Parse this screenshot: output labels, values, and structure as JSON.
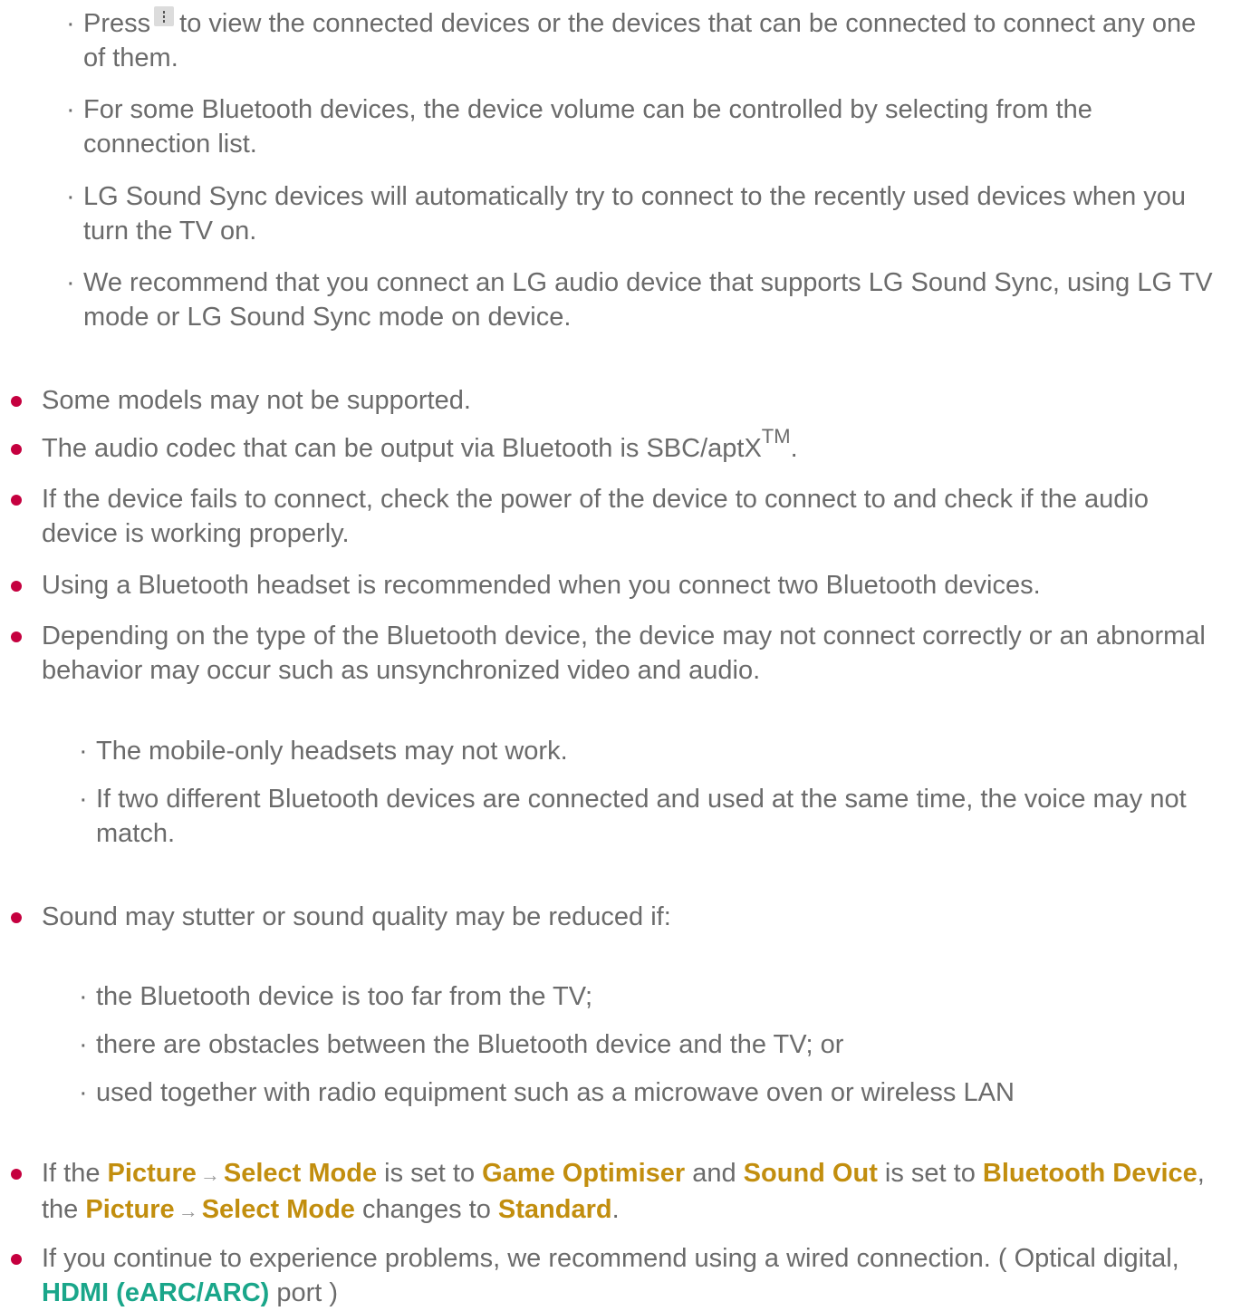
{
  "sub_list_1": [
    {
      "before_icon": "Press",
      "icon": "more-options-icon",
      "after_icon": "to view the connected devices or the devices that can be connected to connect any one of them."
    },
    {
      "text": "For some Bluetooth devices, the device volume can be controlled by selecting from the connection list."
    },
    {
      "text": "LG Sound Sync devices will automatically try to connect to the recently used devices when you turn the TV on."
    },
    {
      "text": "We recommend that you connect an LG audio device that supports LG Sound Sync, using LG TV mode or LG Sound Sync mode on device."
    }
  ],
  "notes": {
    "n1": "Some models may not be supported.",
    "n2_main": "The audio codec that can be output via Bluetooth is SBC/aptX",
    "n2_sup": "TM",
    "n2_end": ".",
    "n3": "If the device fails to connect, check the power of the device to connect to and check if the audio device is working properly.",
    "n4": "Using a Bluetooth headset is recommended when you connect two Bluetooth devices.",
    "n5": "Depending on the type of the Bluetooth device, the device may not connect correctly or an abnormal behavior may occur such as unsynchronized video and audio.",
    "n6": "Sound may stutter or sound quality may be reduced if:",
    "n7": {
      "t1": "If the ",
      "picture": "Picture",
      "arrow": "→",
      "select_mode": "Select Mode",
      "t2": " is set to ",
      "game_optimiser": "Game Optimiser",
      "t3": " and ",
      "sound_out": "Sound Out",
      "t4": " is set to ",
      "bluetooth_device": "Bluetooth Device",
      "t5": ", the ",
      "picture2": "Picture",
      "select_mode2": "Select Mode",
      "t6": " changes to ",
      "standard": "Standard",
      "t7": "."
    },
    "n8": {
      "t1": "If you continue to experience problems, we recommend using a wired connection. ( Optical digital, ",
      "hdmi": "HDMI (eARC/ARC)",
      "t2": " port )"
    }
  },
  "sub_list_2": [
    "The mobile-only headsets may not work.",
    "If two different Bluetooth devices are connected and used at the same time, the voice may not match."
  ],
  "sub_list_3": [
    "the Bluetooth device is too far from the TV;",
    "there are obstacles between the Bluetooth device and the TV; or",
    "used together with radio equipment such as a microwave oven or wireless LAN"
  ],
  "colors": {
    "text": "#6b6b6b",
    "bullet": "#c5003f",
    "highlight": "#c28e0e",
    "link_green": "#1aa68a"
  }
}
